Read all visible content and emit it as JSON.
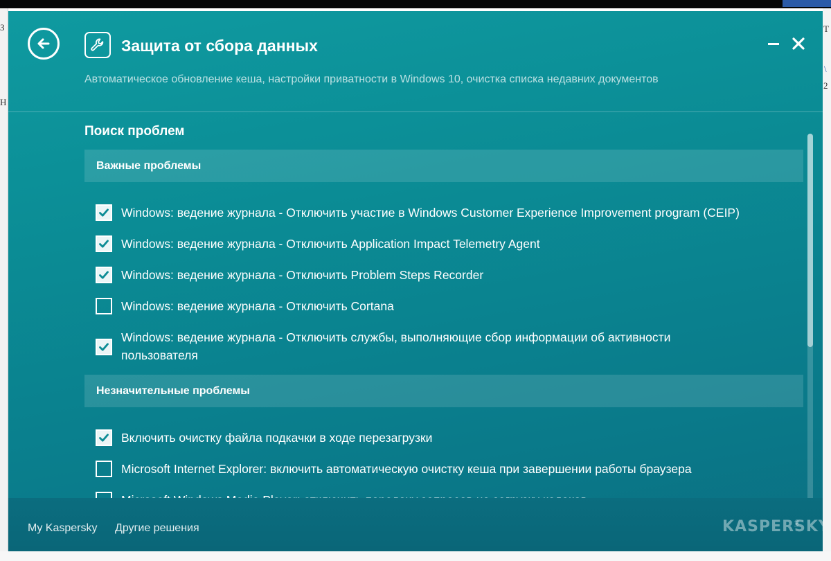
{
  "header": {
    "title": "Защита от сбора данных",
    "subtitle": "Автоматическое обновление кеша, настройки приватности в Windows 10, очистка списка недавних документов",
    "back_icon": "arrow-left-icon",
    "title_icon": "wrench-icon",
    "minimize_glyph": "–",
    "close_glyph": "✕"
  },
  "content": {
    "section_title": "Поиск проблем",
    "groups": [
      {
        "title": "Важные проблемы",
        "items": [
          {
            "label": "Windows: ведение журнала - Отключить участие в Windows Customer Experience Improvement program (CEIP)",
            "checked": true
          },
          {
            "label": "Windows: ведение журнала - Отключить Application Impact Telemetry Agent",
            "checked": true
          },
          {
            "label": "Windows: ведение журнала - Отключить Problem Steps Recorder",
            "checked": true
          },
          {
            "label": "Windows: ведение журнала - Отключить Cortana",
            "checked": false
          },
          {
            "label": "Windows: ведение журнала - Отключить службы, выполняющие сбор информации об активности пользователя",
            "checked": true
          }
        ]
      },
      {
        "title": "Незначительные проблемы",
        "items": [
          {
            "label": "Включить очистку файла подкачки в ходе перезагрузки",
            "checked": true
          },
          {
            "label": "Microsoft Internet Explorer: включить автоматическую очистку кеша при завершении работы браузера",
            "checked": false
          },
          {
            "label": "Microsoft Windows Media Player: отключить передачу запросов на загрузку кодеков",
            "checked": false
          }
        ]
      }
    ]
  },
  "footer": {
    "my_kaspersky": "My Kaspersky",
    "other_solutions": "Другие решения",
    "brand": "KASPERSKY",
    "brand_suffix": "lab"
  },
  "background": {
    "left_glyphs": [
      "З",
      "Н"
    ],
    "right_glyphs": [
      "Т",
      "\\",
      "2"
    ]
  },
  "colors": {
    "window_teal": "#0b8c95",
    "footer_teal": "#0a6678",
    "text": "#ffffff"
  }
}
